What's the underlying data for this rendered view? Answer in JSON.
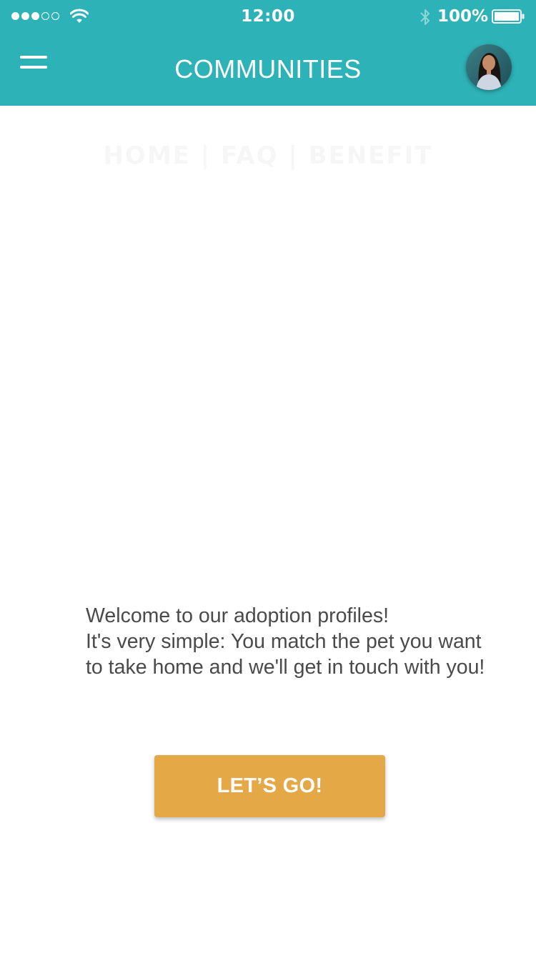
{
  "status_bar": {
    "time": "12:00",
    "battery_percent": "100%",
    "signal_bars_filled": 3,
    "signal_bars_total": 5,
    "battery_level": 1.0
  },
  "header": {
    "title": "COMMUNITIES",
    "background_color": "#2db3b7",
    "menu_icon": "hamburger-menu-icon",
    "avatar": "user-avatar"
  },
  "content": {
    "faded_heading": "HOME | FAQ | BENEFIT",
    "welcome_line1": "Welcome to our adoption profiles!",
    "welcome_line2": "It's very simple: You match the pet you want to take home and we'll get in touch with you!"
  },
  "cta": {
    "label": "LET’S GO!",
    "color": "#e5a847"
  }
}
